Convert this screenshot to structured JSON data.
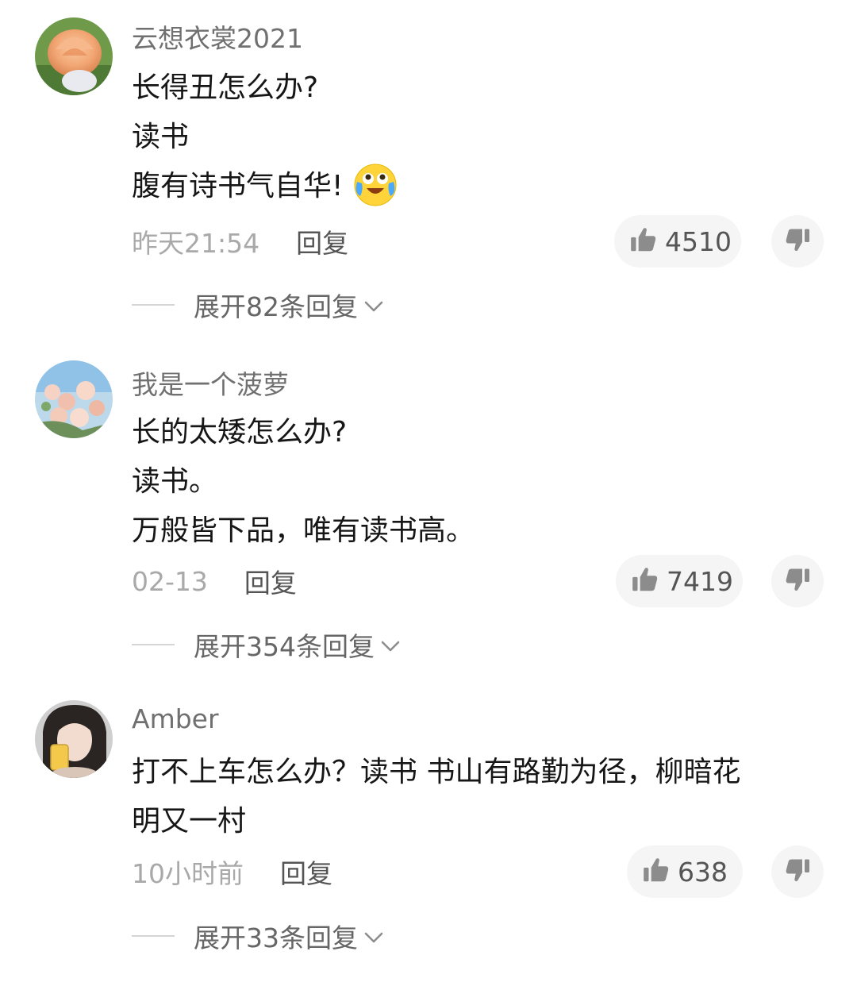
{
  "comments": [
    {
      "username": "云想衣裳2021",
      "lines": [
        "长得丑怎么办?",
        "读书",
        "腹有诗书气自华!"
      ],
      "emoji": "crying-laughing-emoji",
      "time": "昨天21:54",
      "reply_label": "回复",
      "likes": "4510",
      "expand_label": "展开82条回复"
    },
    {
      "username": "我是一个菠萝",
      "lines": [
        "长的太矮怎么办?",
        "读书。",
        "万般皆下品，唯有读书高。"
      ],
      "time": "02-13",
      "reply_label": "回复",
      "likes": "7419",
      "expand_label": "展开354条回复"
    },
    {
      "username": "Amber",
      "lines": [
        "打不上车怎么办？读书 书山有路勤为径，柳暗花",
        "明又一村"
      ],
      "time": "10小时前",
      "reply_label": "回复",
      "likes": "638",
      "expand_label": "展开33条回复"
    }
  ],
  "icons": {
    "like": "thumbs-up-icon",
    "dislike": "thumbs-down-icon",
    "expand": "chevron-down-icon"
  },
  "colors": {
    "username": "#707070",
    "content": "#161616",
    "time": "#a9a9a9",
    "pill_bg": "#f5f5f5"
  }
}
